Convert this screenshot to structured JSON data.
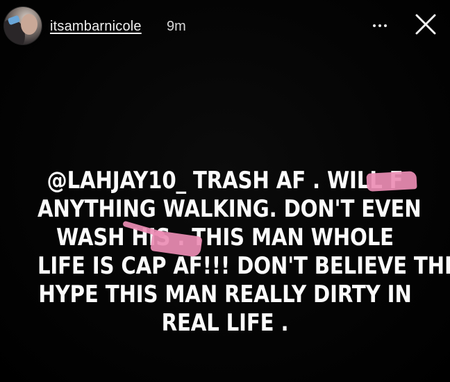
{
  "header": {
    "username": "itsambarnicole",
    "timestamp": "9m"
  },
  "icons": {
    "more": "more-horizontal-icon",
    "close": "close-icon"
  },
  "story": {
    "lines": [
      "@LAHJAY10_  TRASH AF . WILL F",
      "ANYTHING WALKING. DON'T EVEN",
      "WASH HIS    . THIS MAN WHOLE",
      "LIFE IS CAP AF!!! DON'T BELIEVE THE",
      "HYPE THIS MAN REALLY DIRTY IN",
      "REAL LIFE ."
    ],
    "censor_color": "#ec8db4"
  },
  "colors": {
    "background": "#000000",
    "text": "#ffffff"
  }
}
